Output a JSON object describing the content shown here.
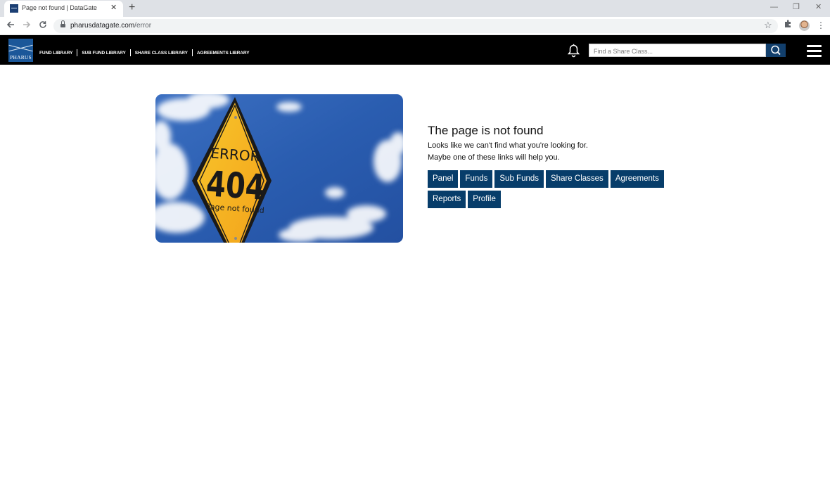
{
  "browser": {
    "tab_title": "Page not found | DataGate",
    "tab_close": "✕",
    "new_tab": "+",
    "url_host": "pharusdatagate.com",
    "url_path": "/error",
    "window_minimize": "—",
    "window_restore": "❐",
    "window_close": "✕",
    "icons": [
      "favicon-icon",
      "back-icon",
      "forward-icon",
      "reload-icon",
      "lock-icon",
      "star-icon",
      "extensions-icon",
      "profile-avatar",
      "menu-kebab-icon"
    ]
  },
  "header": {
    "logo_text": "PHARUS",
    "nav": [
      {
        "label": "FUND LIBRARY"
      },
      {
        "label": "SUB FUND LIBRARY"
      },
      {
        "label": "SHARE CLASS LIBRARY"
      },
      {
        "label": "AGREEMENTS LIBRARY"
      }
    ],
    "search_placeholder": "Find a Share Class...",
    "background_color": "#000000",
    "accent_color": "#123f6c"
  },
  "hero": {
    "sign_line1": "ERROR",
    "sign_line2": "404",
    "sign_line3": "Page not found",
    "sign_color": "#f5b21f",
    "sky_color": "#2a5db0"
  },
  "main": {
    "title": "The page is not found",
    "line1": "Looks like we can't find what you're looking for.",
    "line2": "Maybe one of these links will help you.",
    "links": [
      {
        "label": "Panel"
      },
      {
        "label": "Funds"
      },
      {
        "label": "Sub Funds"
      },
      {
        "label": "Share Classes"
      },
      {
        "label": "Agreements"
      },
      {
        "label": "Reports"
      },
      {
        "label": "Profile"
      }
    ],
    "button_color": "#073d6a"
  }
}
